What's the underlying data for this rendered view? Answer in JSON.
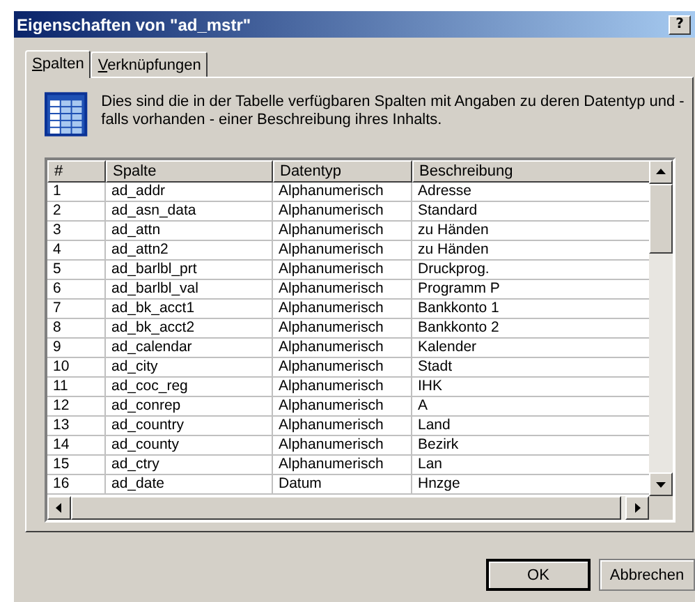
{
  "window": {
    "title": "Eigenschaften von \"ad_mstr\"",
    "help_button": "?"
  },
  "tabs": [
    {
      "label": "Spalten",
      "selected": true
    },
    {
      "label": "Verknüpfungen",
      "selected": false
    }
  ],
  "description": "Dies sind die in der Tabelle verfügbaren Spalten mit Angaben zu deren Datentyp und - falls vorhanden - einer Beschreibung ihres Inhalts.",
  "table": {
    "columns": [
      "#",
      "Spalte",
      "Datentyp",
      "Beschreibung"
    ],
    "rows": [
      [
        "1",
        "ad_addr",
        "Alphanumerisch",
        "Adresse"
      ],
      [
        "2",
        "ad_asn_data",
        "Alphanumerisch",
        "Standard"
      ],
      [
        "3",
        "ad_attn",
        "Alphanumerisch",
        "zu Händen"
      ],
      [
        "4",
        "ad_attn2",
        "Alphanumerisch",
        "zu Händen"
      ],
      [
        "5",
        "ad_barlbl_prt",
        "Alphanumerisch",
        "Druckprog."
      ],
      [
        "6",
        "ad_barlbl_val",
        "Alphanumerisch",
        "Programm P"
      ],
      [
        "7",
        "ad_bk_acct1",
        "Alphanumerisch",
        "Bankkonto 1"
      ],
      [
        "8",
        "ad_bk_acct2",
        "Alphanumerisch",
        "Bankkonto 2"
      ],
      [
        "9",
        "ad_calendar",
        "Alphanumerisch",
        "Kalender"
      ],
      [
        "10",
        "ad_city",
        "Alphanumerisch",
        "Stadt"
      ],
      [
        "11",
        "ad_coc_reg",
        "Alphanumerisch",
        "IHK"
      ],
      [
        "12",
        "ad_conrep",
        "Alphanumerisch",
        "A"
      ],
      [
        "13",
        "ad_country",
        "Alphanumerisch",
        "Land"
      ],
      [
        "14",
        "ad_county",
        "Alphanumerisch",
        "Bezirk"
      ],
      [
        "15",
        "ad_ctry",
        "Alphanumerisch",
        "Lan"
      ],
      [
        "16",
        "ad_date",
        "Datum",
        "Hnzge"
      ]
    ]
  },
  "buttons": [
    "OK",
    "Abbrechen"
  ]
}
